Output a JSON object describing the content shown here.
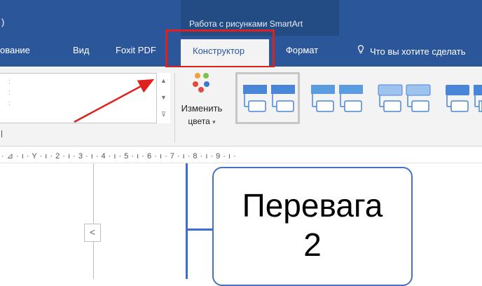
{
  "titlebar": {
    "edge_glyph": ")",
    "contextual_group": "Работа с рисунками SmartArt"
  },
  "tabs": [
    {
      "label": "ование",
      "active": false
    },
    {
      "label": "Вид",
      "active": false
    },
    {
      "label": "Foxit PDF",
      "active": false
    },
    {
      "label": "Конструктор",
      "active": true
    },
    {
      "label": "Формат",
      "active": false
    }
  ],
  "tell_me": {
    "icon": "lightbulb-icon",
    "label": "Что вы хотите сделать"
  },
  "ribbon": {
    "change_colors": {
      "line1": "Изменить",
      "line2": "цвета",
      "icon": "color-palette-icon",
      "caret": "▾"
    },
    "gallery_scroll": {
      "up": "▲",
      "down": "▼",
      "more": "⊽"
    },
    "left_dots": ":\n:\n:"
  },
  "ruler": {
    "text": "· ⊿ · ı · Y · ı · 2 · ı · 3 · ı · 4 · ı · 5 · ı · 6 · ı · 7 · ı · 8 · ı · 9 · ı ·"
  },
  "document": {
    "smartart_line1": "Перевага",
    "smartart_line2": "2",
    "collapse_glyph": "<"
  },
  "colors": {
    "ribbon_blue": "#2b579a",
    "highlight_red": "#e0201c",
    "smartart_blue": "#4472c4"
  }
}
